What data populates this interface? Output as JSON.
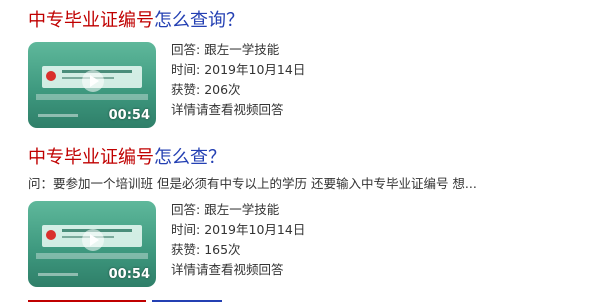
{
  "results": [
    {
      "title_highlight": "中专毕业证编号",
      "title_rest": "怎么查询？",
      "video": {
        "duration": "00:54"
      },
      "answer_label": "回答:",
      "answer_value": "跟左一学技能",
      "time_label": "时间:",
      "time_value": "2019年10月14日",
      "likes_label": "获赞:",
      "likes_value": "206次",
      "details_link": "详情请查看视频回答"
    },
    {
      "title_highlight": "中专毕业证编号",
      "title_rest": "怎么查？",
      "snippet": "问：要参加一个培训班 但是必须有中专以上的学历 还要输入中专毕业证编号 想...",
      "video": {
        "duration": "00:54"
      },
      "answer_label": "回答:",
      "answer_value": "跟左一学技能",
      "time_label": "时间:",
      "time_value": "2019年10月14日",
      "likes_label": "获赞:",
      "likes_value": "165次",
      "details_link": "详情请查看视频回答"
    }
  ],
  "colors": {
    "title_highlight": "#c00000",
    "title_link": "#2440b3",
    "thumbnail_green": "#4fa88d"
  }
}
